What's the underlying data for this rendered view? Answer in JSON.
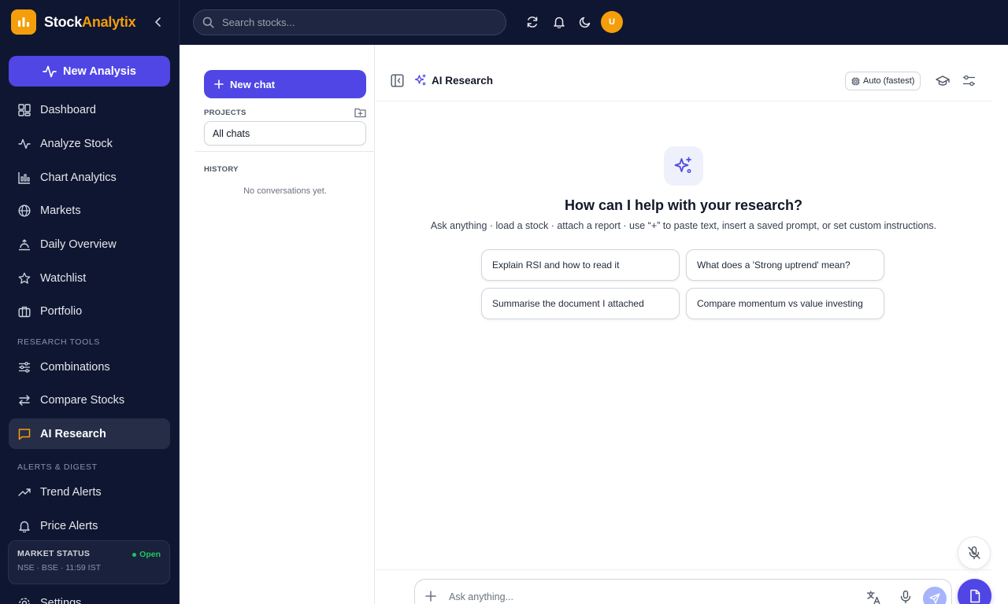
{
  "brand": {
    "name_part1": "Stock",
    "name_part2": "Analytix",
    "accent_color": "#f59e0b"
  },
  "sidebar": {
    "new_analysis_label": "New Analysis",
    "items": [
      {
        "label": "Dashboard",
        "icon": "dashboard-icon"
      },
      {
        "label": "Analyze Stock",
        "icon": "activity-icon"
      },
      {
        "label": "Chart Analytics",
        "icon": "chart-icon"
      },
      {
        "label": "Markets",
        "icon": "globe-icon"
      },
      {
        "label": "Daily Overview",
        "icon": "sunrise-icon"
      },
      {
        "label": "Watchlist",
        "icon": "star-icon"
      },
      {
        "label": "Portfolio",
        "icon": "briefcase-icon"
      }
    ],
    "research_section_label": "RESEARCH TOOLS",
    "research_items": [
      {
        "label": "Combinations",
        "icon": "sliders-icon"
      },
      {
        "label": "Compare Stocks",
        "icon": "compare-arrows-icon"
      },
      {
        "label": "AI Research",
        "icon": "chat-icon",
        "active": true
      }
    ],
    "alerts_section_label": "ALERTS & DIGEST",
    "alert_items": [
      {
        "label": "Trend Alerts",
        "icon": "trending-up-icon"
      },
      {
        "label": "Price Alerts",
        "icon": "bell-icon"
      }
    ],
    "settings_label": "Settings",
    "market_status": {
      "title": "MARKET STATUS",
      "status": "Open",
      "subtitle": "NSE · BSE · 11:59 IST",
      "status_color": "#22c55e"
    }
  },
  "topbar": {
    "search_placeholder": "Search stocks...",
    "avatar_initial": "U"
  },
  "chat_panel": {
    "new_chat_label": "New chat",
    "projects_label": "PROJECTS",
    "all_chats_label": "All chats",
    "history_label": "HISTORY",
    "empty_history": "No conversations yet."
  },
  "main": {
    "title": "AI Research",
    "model_label": "Auto (fastest)",
    "hero_title": "How can I help with your research?",
    "hero_subtitle": "Ask anything · load a stock · attach a report · use “+” to paste text, insert a saved prompt, or set custom instructions.",
    "suggestions": [
      "Explain RSI and how to read it",
      "What does a 'Strong uptrend' mean?",
      "Summarise the document I attached",
      "Compare momentum vs value investing"
    ],
    "composer_placeholder": "Ask anything..."
  },
  "colors": {
    "primary": "#4f46e5",
    "sidebar_bg": "#0f1631"
  }
}
